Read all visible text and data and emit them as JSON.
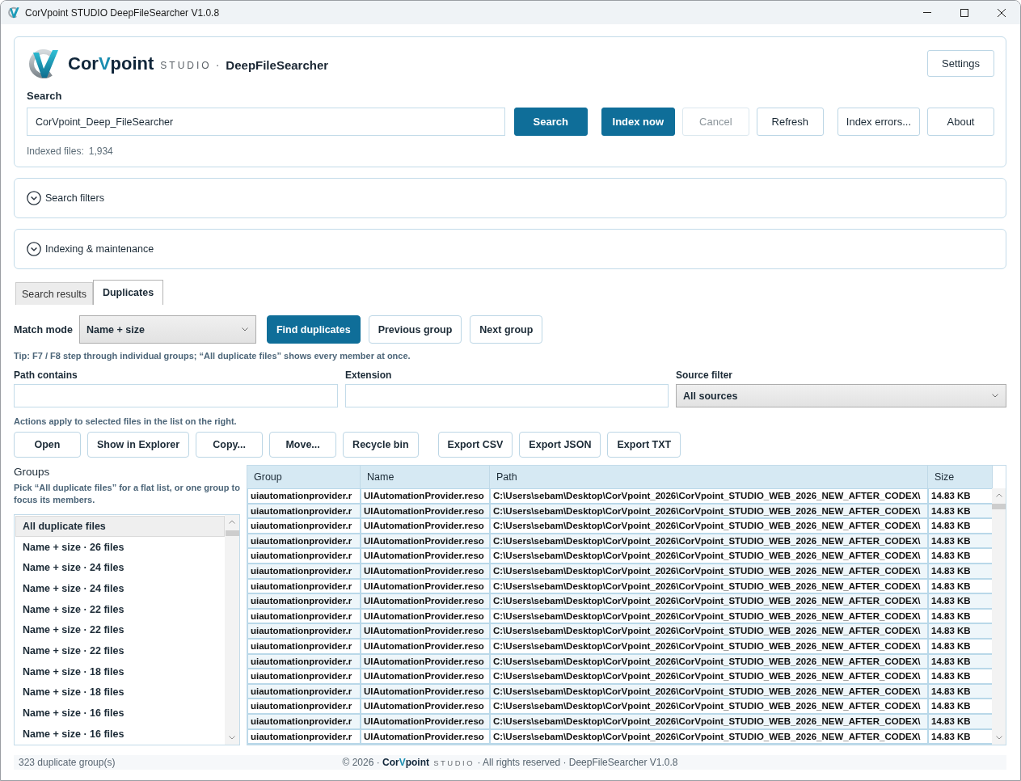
{
  "window": {
    "title": "CorVpoint STUDIO DeepFileSearcher V1.0.8"
  },
  "header": {
    "brand_parts": [
      {
        "text": "Cor",
        "kind": "brand"
      },
      {
        "text": "V",
        "kind": "accent"
      },
      {
        "text": "point",
        "kind": "brand"
      }
    ],
    "studio": "STUDIO",
    "separator": "·",
    "app_name": "DeepFileSearcher",
    "settings_button": "Settings",
    "search": {
      "label": "Search",
      "value": "CorVpoint_Deep_FileSearcher"
    },
    "button_groups": [
      [
        {
          "label": "Search",
          "kind": "primary",
          "disabled": false
        }
      ],
      [
        {
          "label": "Index now",
          "kind": "primary",
          "disabled": false
        },
        {
          "label": "Cancel",
          "kind": "secondary",
          "disabled": true
        },
        {
          "label": "Refresh",
          "kind": "secondary",
          "disabled": false
        }
      ],
      [
        {
          "label": "Index errors...",
          "kind": "secondary",
          "disabled": false
        },
        {
          "label": "About",
          "kind": "secondary",
          "disabled": false
        }
      ]
    ],
    "indexed_label": "Indexed files:",
    "indexed_count": "1,934"
  },
  "sections": [
    {
      "label": "Search filters",
      "expanded": false
    },
    {
      "label": "Indexing & maintenance",
      "expanded": false
    }
  ],
  "tabs": [
    {
      "label": "Search results",
      "selected": false
    },
    {
      "label": "Duplicates",
      "selected": true
    }
  ],
  "duplicates": {
    "match_mode": {
      "label": "Match mode",
      "value": "Name + size"
    },
    "buttons": [
      {
        "label": "Find duplicates",
        "kind": "primary"
      },
      {
        "label": "Previous group",
        "kind": "secondary"
      },
      {
        "label": "Next group",
        "kind": "secondary"
      }
    ],
    "tip": "Tip: F7 / F8 step through individual groups; “All duplicate files” shows every member at once.",
    "filters": [
      {
        "label": "Path contains",
        "kind": "text"
      },
      {
        "label": "Extension",
        "kind": "text"
      },
      {
        "label": "Source filter",
        "kind": "select",
        "value": "All sources"
      }
    ],
    "actions_note": "Actions apply to selected files in the list on the right.",
    "action_groups": [
      [
        "Open",
        "Show in Explorer",
        "Copy...",
        "Move...",
        "Recycle bin"
      ],
      [
        "Export CSV",
        "Export JSON",
        "Export TXT"
      ]
    ],
    "groups": {
      "title": "Groups",
      "hint": "Pick “All duplicate files” for a flat list, or one group to focus its members.",
      "items": [
        {
          "label": "All duplicate files",
          "selected": true
        },
        {
          "label": "Name + size · 26 files",
          "selected": false
        },
        {
          "label": "Name + size · 24 files",
          "selected": false
        },
        {
          "label": "Name + size · 24 files",
          "selected": false
        },
        {
          "label": "Name + size · 22 files",
          "selected": false
        },
        {
          "label": "Name + size · 22 files",
          "selected": false
        },
        {
          "label": "Name + size · 22 files",
          "selected": false
        },
        {
          "label": "Name + size · 18 files",
          "selected": false
        },
        {
          "label": "Name + size · 18 files",
          "selected": false
        },
        {
          "label": "Name + size · 16 files",
          "selected": false
        },
        {
          "label": "Name + size · 16 files",
          "selected": false
        }
      ]
    },
    "table": {
      "columns": [
        "Group",
        "Name",
        "Path",
        "Size"
      ],
      "rows": [
        [
          "uiautomationprovider.r",
          "UIAutomationProvider.reso",
          "C:\\Users\\sebam\\Desktop\\CorVpoint_2026\\CorVpoint_STUDIO_WEB_2026_NEW_AFTER_CODEX\\",
          "14.83 KB"
        ],
        [
          "uiautomationprovider.r",
          "UIAutomationProvider.reso",
          "C:\\Users\\sebam\\Desktop\\CorVpoint_2026\\CorVpoint_STUDIO_WEB_2026_NEW_AFTER_CODEX\\",
          "14.83 KB"
        ],
        [
          "uiautomationprovider.r",
          "UIAutomationProvider.reso",
          "C:\\Users\\sebam\\Desktop\\CorVpoint_2026\\CorVpoint_STUDIO_WEB_2026_NEW_AFTER_CODEX\\",
          "14.83 KB"
        ],
        [
          "uiautomationprovider.r",
          "UIAutomationProvider.reso",
          "C:\\Users\\sebam\\Desktop\\CorVpoint_2026\\CorVpoint_STUDIO_WEB_2026_NEW_AFTER_CODEX\\",
          "14.83 KB"
        ],
        [
          "uiautomationprovider.r",
          "UIAutomationProvider.reso",
          "C:\\Users\\sebam\\Desktop\\CorVpoint_2026\\CorVpoint_STUDIO_WEB_2026_NEW_AFTER_CODEX\\",
          "14.83 KB"
        ],
        [
          "uiautomationprovider.r",
          "UIAutomationProvider.reso",
          "C:\\Users\\sebam\\Desktop\\CorVpoint_2026\\CorVpoint_STUDIO_WEB_2026_NEW_AFTER_CODEX\\",
          "14.83 KB"
        ],
        [
          "uiautomationprovider.r",
          "UIAutomationProvider.reso",
          "C:\\Users\\sebam\\Desktop\\CorVpoint_2026\\CorVpoint_STUDIO_WEB_2026_NEW_AFTER_CODEX\\",
          "14.83 KB"
        ],
        [
          "uiautomationprovider.r",
          "UIAutomationProvider.reso",
          "C:\\Users\\sebam\\Desktop\\CorVpoint_2026\\CorVpoint_STUDIO_WEB_2026_NEW_AFTER_CODEX\\",
          "14.83 KB"
        ],
        [
          "uiautomationprovider.r",
          "UIAutomationProvider.reso",
          "C:\\Users\\sebam\\Desktop\\CorVpoint_2026\\CorVpoint_STUDIO_WEB_2026_NEW_AFTER_CODEX\\",
          "14.83 KB"
        ],
        [
          "uiautomationprovider.r",
          "UIAutomationProvider.reso",
          "C:\\Users\\sebam\\Desktop\\CorVpoint_2026\\CorVpoint_STUDIO_WEB_2026_NEW_AFTER_CODEX\\",
          "14.83 KB"
        ],
        [
          "uiautomationprovider.r",
          "UIAutomationProvider.reso",
          "C:\\Users\\sebam\\Desktop\\CorVpoint_2026\\CorVpoint_STUDIO_WEB_2026_NEW_AFTER_CODEX\\",
          "14.83 KB"
        ],
        [
          "uiautomationprovider.r",
          "UIAutomationProvider.reso",
          "C:\\Users\\sebam\\Desktop\\CorVpoint_2026\\CorVpoint_STUDIO_WEB_2026_NEW_AFTER_CODEX\\",
          "14.83 KB"
        ],
        [
          "uiautomationprovider.r",
          "UIAutomationProvider.reso",
          "C:\\Users\\sebam\\Desktop\\CorVpoint_2026\\CorVpoint_STUDIO_WEB_2026_NEW_AFTER_CODEX\\",
          "14.83 KB"
        ],
        [
          "uiautomationprovider.r",
          "UIAutomationProvider.reso",
          "C:\\Users\\sebam\\Desktop\\CorVpoint_2026\\CorVpoint_STUDIO_WEB_2026_NEW_AFTER_CODEX\\",
          "14.83 KB"
        ],
        [
          "uiautomationprovider.r",
          "UIAutomationProvider.reso",
          "C:\\Users\\sebam\\Desktop\\CorVpoint_2026\\CorVpoint_STUDIO_WEB_2026_NEW_AFTER_CODEX\\",
          "14.83 KB"
        ],
        [
          "uiautomationprovider.r",
          "UIAutomationProvider.reso",
          "C:\\Users\\sebam\\Desktop\\CorVpoint_2026\\CorVpoint_STUDIO_WEB_2026_NEW_AFTER_CODEX\\",
          "14.83 KB"
        ],
        [
          "uiautomationprovider.r",
          "UIAutomationProvider.reso",
          "C:\\Users\\sebam\\Desktop\\CorVpoint_2026\\CorVpoint_STUDIO_WEB_2026_NEW_AFTER_CODEX\\",
          "14.83 KB"
        ]
      ]
    }
  },
  "status_bar": {
    "summary": "323 duplicate group(s)",
    "copyright_parts": [
      {
        "text": "© 2026 · ",
        "kind": "plain"
      },
      {
        "text": "Cor",
        "kind": "brand"
      },
      {
        "text": "V",
        "kind": "accent"
      },
      {
        "text": "point",
        "kind": "brand"
      },
      {
        "text": " STUDIO",
        "kind": "studio"
      },
      {
        "text": " · All rights reserved · DeepFileSearcher V1.0.8",
        "kind": "plain"
      }
    ]
  }
}
